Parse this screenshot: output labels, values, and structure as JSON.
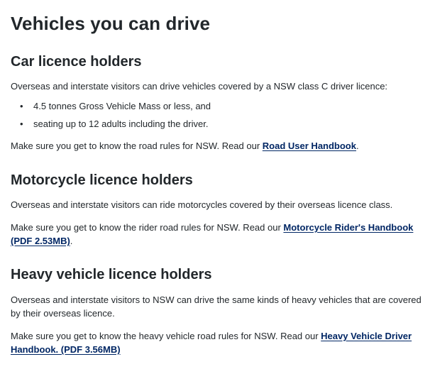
{
  "page": {
    "title": "Vehicles you can drive"
  },
  "car": {
    "heading": "Car licence holders",
    "intro": "Overseas and interstate visitors can drive vehicles covered by a NSW class C driver licence:",
    "items": [
      "4.5 tonnes Gross Vehicle Mass or less, and",
      "seating up to 12 adults including the driver."
    ],
    "bullet": "•",
    "rules_prefix": "Make sure you get to know the road rules for NSW. Read our ",
    "rules_link": "Road User Handbook",
    "rules_suffix": "."
  },
  "motorcycle": {
    "heading": "Motorcycle licence holders",
    "intro": "Overseas and interstate visitors can ride motorcycles covered by their overseas licence class.",
    "rules_prefix": "Make sure you get to know the rider road rules for NSW. Read our ",
    "rules_link": "Motorcycle Rider's Handbook (PDF 2.53MB)",
    "rules_suffix": "."
  },
  "heavy": {
    "heading": "Heavy vehicle licence holders",
    "intro": "Overseas and interstate visitors to NSW can drive the same kinds of heavy vehicles that are covered by their overseas licence.",
    "rules_prefix": "Make sure you get to know the heavy vehicle road rules for NSW. Read our ",
    "rules_link": "Heavy Vehicle Driver Handbook. (PDF 3.56MB)"
  },
  "colors": {
    "text": "#22272b",
    "link": "#002664",
    "background": "#ffffff"
  }
}
